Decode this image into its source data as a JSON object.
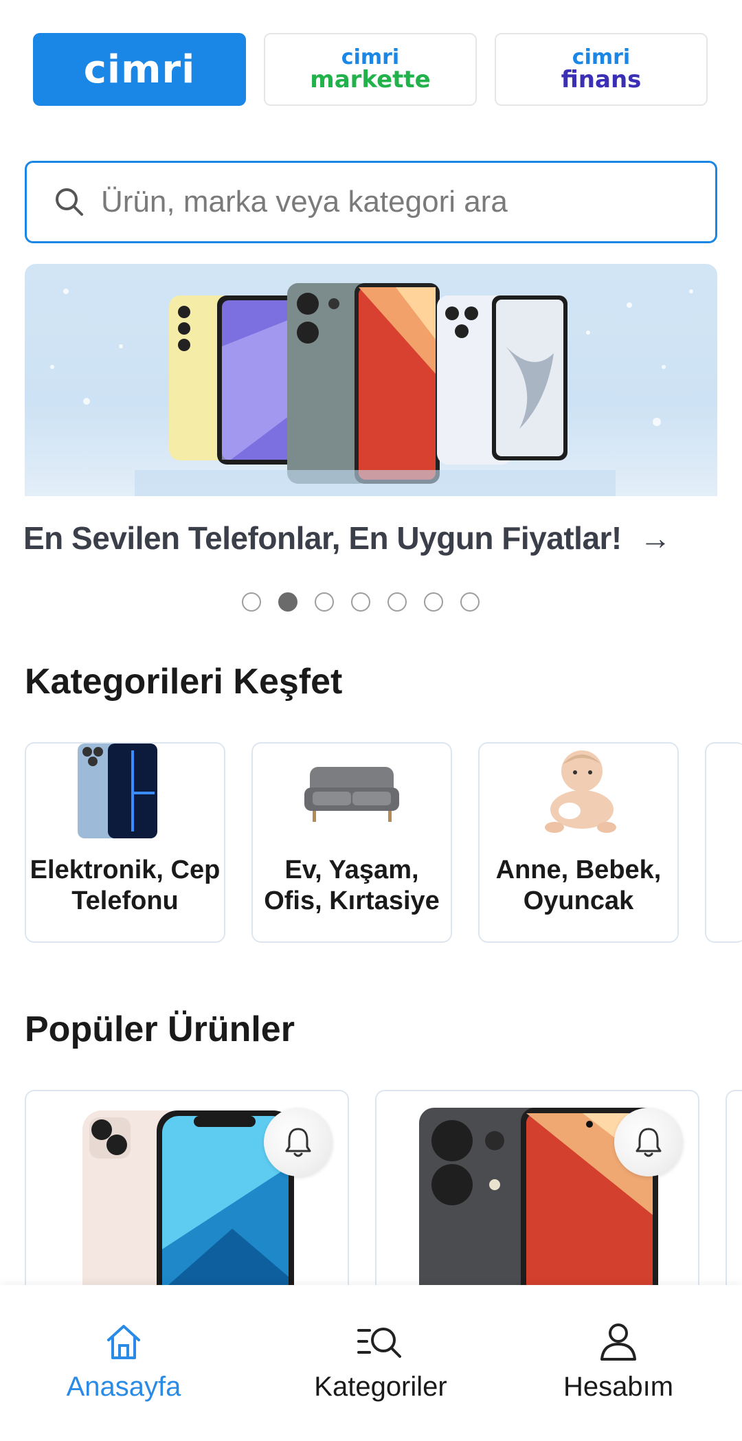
{
  "brands": [
    {
      "main": "cimri"
    },
    {
      "top": "cimri",
      "sub": "markette",
      "sub_color": "#21b24b"
    },
    {
      "top": "cimri",
      "sub": "finans",
      "sub_color": "#3b2fb6"
    }
  ],
  "search": {
    "placeholder": "Ürün, marka veya kategori ara"
  },
  "banner": {
    "caption": "En Sevilen Telefonlar, En Uygun Fiyatlar!",
    "arrow": "→",
    "slide_count": 7,
    "active_slide": 2
  },
  "categories_section": {
    "title": "Kategorileri Keşfet",
    "items": [
      {
        "label": "Elektronik, Cep Telefonu",
        "icon": "phone-image"
      },
      {
        "label": "Ev, Yaşam, Ofis, Kırtasiye",
        "icon": "sofa-image"
      },
      {
        "label": "Anne, Bebek, Oyuncak",
        "icon": "baby-image"
      }
    ]
  },
  "popular_section": {
    "title": "Popüler Ürünler",
    "items": [
      {
        "icon": "iphone-image",
        "alert_icon": "bell-icon"
      },
      {
        "icon": "redmi-phone-image",
        "alert_icon": "bell-icon"
      }
    ]
  },
  "bottom_nav": [
    {
      "label": "Anasayfa",
      "icon": "home-icon",
      "active": true
    },
    {
      "label": "Kategoriler",
      "icon": "category-search-icon",
      "active": false
    },
    {
      "label": "Hesabım",
      "icon": "user-icon",
      "active": false
    }
  ],
  "colors": {
    "accent": "#1a86e6",
    "active_nav": "#2a8be6"
  }
}
